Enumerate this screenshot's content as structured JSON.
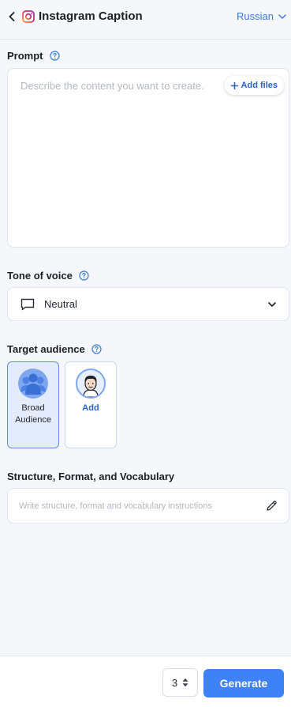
{
  "header": {
    "title": "Instagram Caption",
    "language": "Russian"
  },
  "prompt": {
    "label": "Prompt",
    "placeholder": "Describe the content you want to create.",
    "value": "",
    "add_files_label": "Add files"
  },
  "tone": {
    "label": "Tone of voice",
    "value": "Neutral"
  },
  "audience": {
    "label": "Target audience",
    "options": [
      {
        "label": "Broad Audience",
        "selected": true
      },
      {
        "label": "Add",
        "selected": false
      }
    ]
  },
  "structure": {
    "label": "Structure, Format, and Vocabulary",
    "placeholder": "Write structure, format and vocabulary instructions",
    "value": ""
  },
  "footer": {
    "count": "3",
    "generate_label": "Generate"
  },
  "colors": {
    "accent": "#3f82f7",
    "link": "#2b63c4",
    "background": "#f5f7fb"
  },
  "icons": {
    "back": "chevron-left-icon",
    "brand": "instagram-icon",
    "language": "chevron-down-icon",
    "help": "question-circle-icon",
    "add_files": "plus-icon",
    "tone": "speech-bubble-icon",
    "tone_dropdown": "chevron-down-icon",
    "broad_audience": "group-icon",
    "add_audience": "person-avatar-icon",
    "structure": "pencil-icon",
    "stepper": "up-down-arrows-icon"
  }
}
